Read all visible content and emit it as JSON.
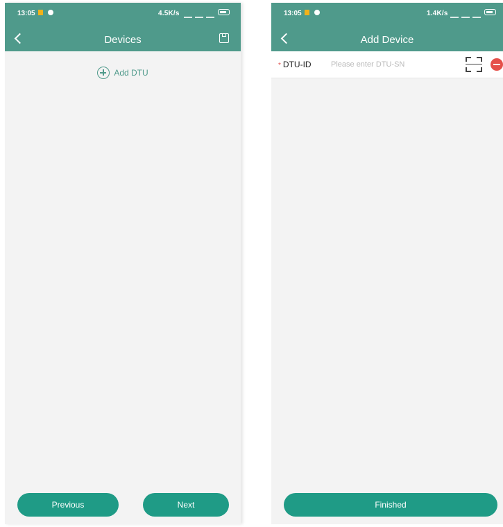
{
  "colors": {
    "accent": "#4f9a8b",
    "button": "#1f9b86",
    "background": "#f3f3f3",
    "remove": "#e5504a"
  },
  "devices_screen": {
    "status_bar": {
      "time": "13:05",
      "net_speed": "4.5K/s"
    },
    "header": {
      "title": "Devices",
      "back_icon": "chevron-left-icon",
      "save_icon": "save-icon"
    },
    "add_dtu": {
      "label": "Add DTU",
      "icon": "plus-circle-icon"
    },
    "buttons": {
      "previous": "Previous",
      "next": "Next"
    }
  },
  "add_device_screen": {
    "status_bar": {
      "time": "13:05",
      "net_speed": "1.4K/s"
    },
    "header": {
      "title": "Add Device",
      "back_icon": "chevron-left-icon"
    },
    "dtu_field": {
      "required_mark": "*",
      "label": "DTU-ID",
      "value": "",
      "placeholder": "Please enter DTU-SN",
      "scan_icon": "scan-icon",
      "remove_icon": "remove-icon"
    },
    "buttons": {
      "finished": "Finished"
    }
  }
}
